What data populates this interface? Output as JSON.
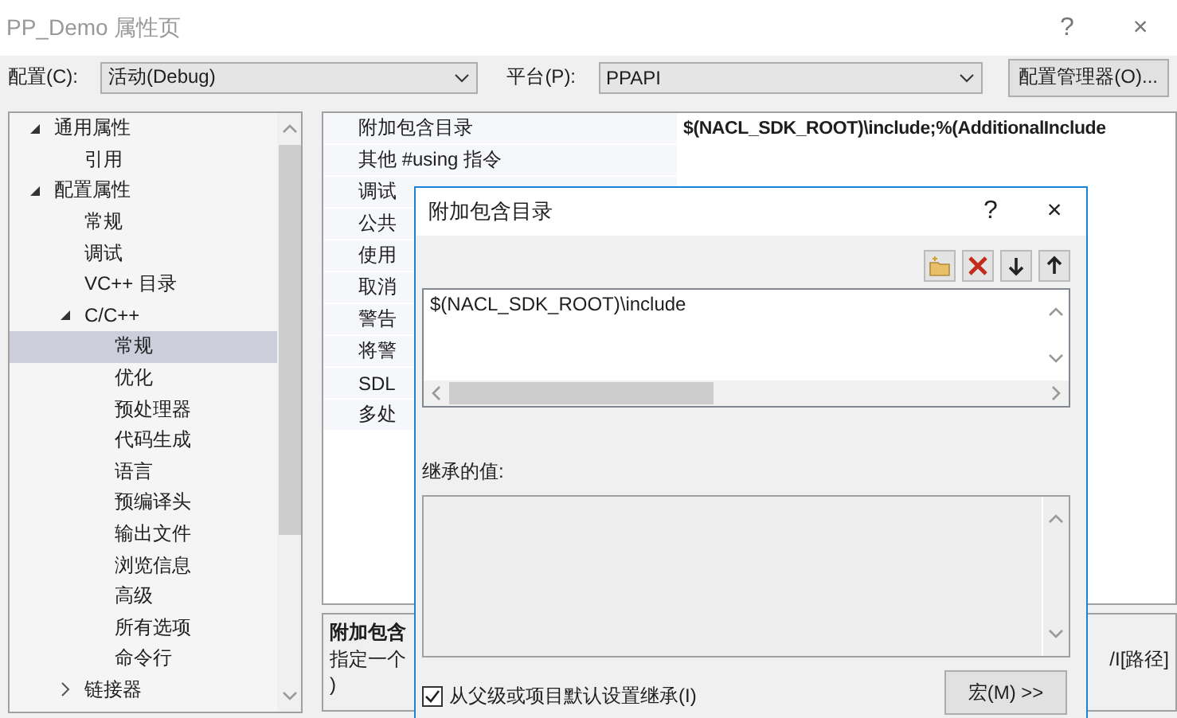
{
  "window": {
    "title": "PP_Demo 属性页",
    "help": "?",
    "close": "×"
  },
  "toolbar": {
    "config_label": "配置(C):",
    "config_value": "活动(Debug)",
    "platform_label": "平台(P):",
    "platform_value": "PPAPI",
    "manager_button": "配置管理器(O)..."
  },
  "tree": [
    {
      "label": "通用属性",
      "expanded": true,
      "selected": false,
      "children": [
        {
          "label": "引用",
          "selected": false
        }
      ]
    },
    {
      "label": "配置属性",
      "expanded": true,
      "selected": false,
      "children": [
        {
          "label": "常规",
          "selected": false
        },
        {
          "label": "调试",
          "selected": false
        },
        {
          "label": "VC++ 目录",
          "selected": false
        },
        {
          "label": "C/C++",
          "expanded": true,
          "selected": false,
          "children": [
            {
              "label": "常规",
              "selected": true
            },
            {
              "label": "优化",
              "selected": false
            },
            {
              "label": "预处理器",
              "selected": false
            },
            {
              "label": "代码生成",
              "selected": false
            },
            {
              "label": "语言",
              "selected": false
            },
            {
              "label": "预编译头",
              "selected": false
            },
            {
              "label": "输出文件",
              "selected": false
            },
            {
              "label": "浏览信息",
              "selected": false
            },
            {
              "label": "高级",
              "selected": false
            },
            {
              "label": "所有选项",
              "selected": false
            },
            {
              "label": "命令行",
              "selected": false
            }
          ]
        },
        {
          "label": "链接器",
          "expanded": false,
          "selected": false
        }
      ]
    }
  ],
  "properties": [
    {
      "name": "附加包含目录",
      "value": "$(NACL_SDK_ROOT)\\include;%(AdditionalInclude"
    },
    {
      "name": "其他 #using 指令"
    },
    {
      "name": "调试"
    },
    {
      "name": "公共"
    },
    {
      "name": "使用"
    },
    {
      "name": "取消"
    },
    {
      "name": "警告"
    },
    {
      "name": "将警"
    },
    {
      "name": "SDL"
    },
    {
      "name": "多处"
    }
  ],
  "description": {
    "title": "附加包含",
    "line_1_left": "指定一个",
    "line_1_right": "/I[路径]",
    "line_2": ")"
  },
  "dialog": {
    "title": "附加包含目录",
    "help": "?",
    "close": "×",
    "entries": [
      "$(NACL_SDK_ROOT)\\include"
    ],
    "inherited_label": "继承的值:",
    "inherit_checkbox": {
      "label": "从父级或项目默认设置继承(I)",
      "checked": true
    },
    "macro_button": "宏(M) >>"
  }
}
